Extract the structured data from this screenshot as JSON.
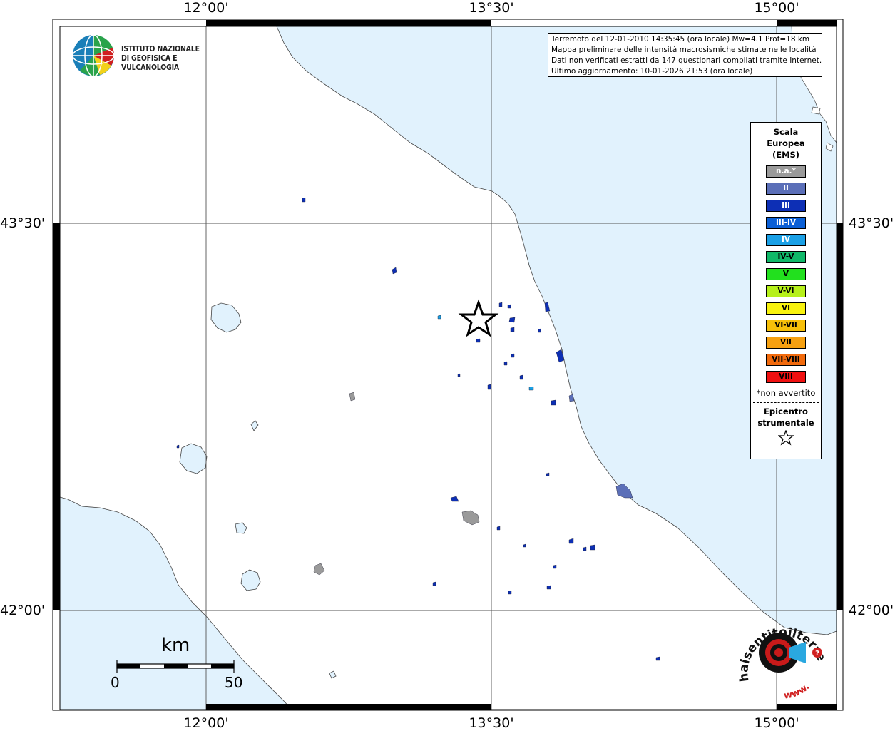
{
  "axes": {
    "top": [
      "12°00'",
      "13°30'",
      "15°00'"
    ],
    "bottom": [
      "12°00'",
      "13°30'",
      "15°00'"
    ],
    "left": [
      "43°30'",
      "42°00'"
    ],
    "right": [
      "43°30'",
      "42°00'"
    ]
  },
  "institute": {
    "line1": "ISTITUTO NAZIONALE",
    "line2": "DI GEOFISICA E VULCANOLOGIA"
  },
  "info": {
    "line1": "Terremoto del 12-01-2010 14:35:45 (ora locale) Mw=4.1 Prof=18 km",
    "line2": "Mappa preliminare delle intensità macrosismiche stimate nelle località",
    "line3": "Dati non verificati estratti da 147 questionari compilati tramite Internet.",
    "line4": "Ultimo aggiornamento: 10-01-2026 21:53 (ora locale)"
  },
  "legend": {
    "title_line1": "Scala",
    "title_line2": "Europea",
    "title_line3": "(EMS)",
    "classes": [
      {
        "label": "n.a.*",
        "color": "#9a9a9a",
        "text": "#ffffff"
      },
      {
        "label": "II",
        "color": "#5b6fb8",
        "text": "#ffffff"
      },
      {
        "label": "III",
        "color": "#0d2fb5",
        "text": "#ffffff"
      },
      {
        "label": "III-IV",
        "color": "#0a5fd6",
        "text": "#ffffff"
      },
      {
        "label": "IV",
        "color": "#1aa0e6",
        "text": "#ffffff"
      },
      {
        "label": "IV-V",
        "color": "#10b868",
        "text": "#000000"
      },
      {
        "label": "V",
        "color": "#22e01e",
        "text": "#000000"
      },
      {
        "label": "V-VI",
        "color": "#b6f01a",
        "text": "#000000"
      },
      {
        "label": "VI",
        "color": "#f8f20e",
        "text": "#000000"
      },
      {
        "label": "VI-VII",
        "color": "#f7c00a",
        "text": "#000000"
      },
      {
        "label": "VII",
        "color": "#f6a010",
        "text": "#000000"
      },
      {
        "label": "VII-VIII",
        "color": "#f26a0c",
        "text": "#000000"
      },
      {
        "label": "VIII",
        "color": "#f01010",
        "text": "#000000"
      }
    ],
    "not_felt_note": "*non avvertito",
    "epicenter_line1": "Epicentro",
    "epicenter_line2": "strumentale"
  },
  "scalebar": {
    "unit": "km",
    "start": "0",
    "end": "50"
  },
  "hst": {
    "arc_text": "haisentitoilterremoto.it",
    "www": "www."
  },
  "colors": {
    "sea": "#e1f2fd",
    "land": "#ffffff",
    "grid": "#555555"
  }
}
